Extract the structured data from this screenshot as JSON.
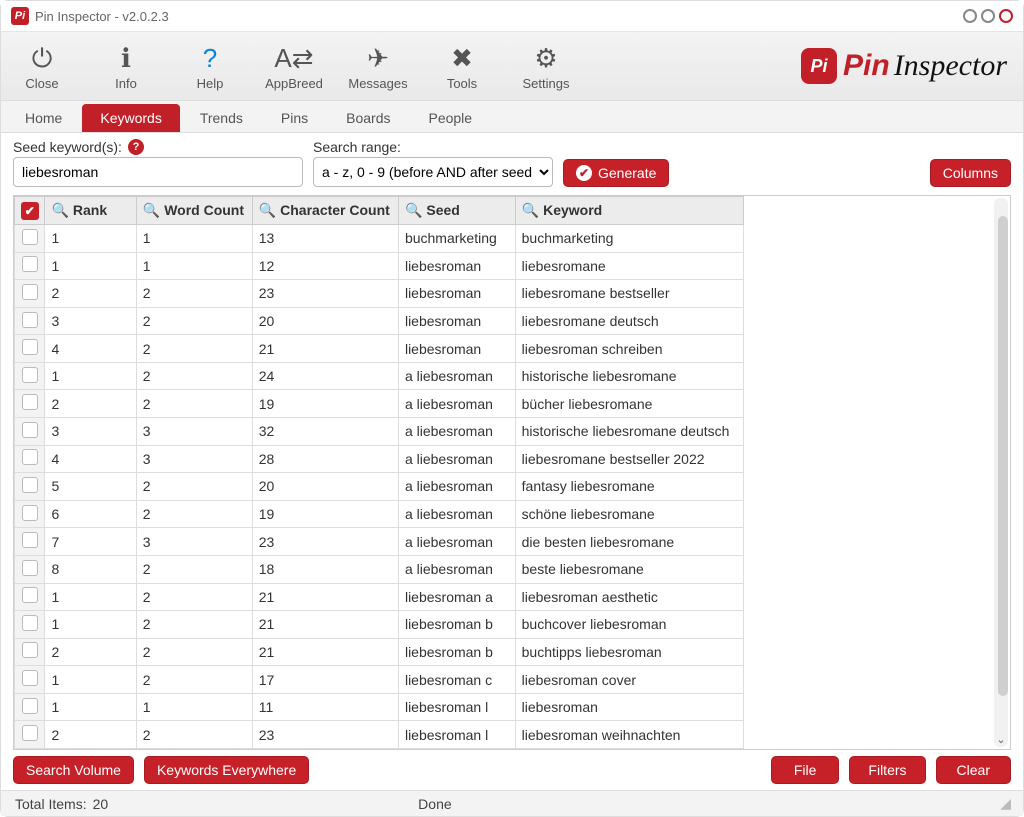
{
  "window": {
    "title": "Pin Inspector - v2.0.2.3"
  },
  "brand": {
    "badge": "Pi",
    "name1": "Pin",
    "name2": "Inspector"
  },
  "ribbon": {
    "items": [
      {
        "key": "close",
        "label": "Close",
        "glyph": "⏻"
      },
      {
        "key": "info",
        "label": "Info",
        "glyph": "ℹ"
      },
      {
        "key": "help",
        "label": "Help",
        "glyph": "?"
      },
      {
        "key": "appbreed",
        "label": "AppBreed",
        "glyph": "A⇄"
      },
      {
        "key": "messages",
        "label": "Messages",
        "glyph": "✈"
      },
      {
        "key": "tools",
        "label": "Tools",
        "glyph": "✖"
      },
      {
        "key": "settings",
        "label": "Settings",
        "glyph": "⚙"
      }
    ]
  },
  "tabs": [
    "Home",
    "Keywords",
    "Trends",
    "Pins",
    "Boards",
    "People"
  ],
  "activeTab": "Keywords",
  "search": {
    "seed_label": "Seed keyword(s):",
    "seed_value": "liebesroman",
    "range_label": "Search range:",
    "range_value": "a - z, 0 - 9 (before AND after seed",
    "generate": "Generate",
    "columns": "Columns"
  },
  "table": {
    "headers": {
      "rank": "Rank",
      "word_count": "Word Count",
      "char_count": "Character Count",
      "seed": "Seed",
      "keyword": "Keyword"
    },
    "rows": [
      {
        "rank": "1",
        "wc": "1",
        "cc": "13",
        "seed": "buchmarketing",
        "kw": "buchmarketing"
      },
      {
        "rank": "1",
        "wc": "1",
        "cc": "12",
        "seed": " liebesroman",
        "kw": "liebesromane"
      },
      {
        "rank": "2",
        "wc": "2",
        "cc": "23",
        "seed": " liebesroman",
        "kw": "liebesromane bestseller"
      },
      {
        "rank": "3",
        "wc": "2",
        "cc": "20",
        "seed": " liebesroman",
        "kw": "liebesromane deutsch"
      },
      {
        "rank": "4",
        "wc": "2",
        "cc": "21",
        "seed": " liebesroman",
        "kw": "liebesroman schreiben"
      },
      {
        "rank": "1",
        "wc": "2",
        "cc": "24",
        "seed": "a liebesroman",
        "kw": "historische liebesromane"
      },
      {
        "rank": "2",
        "wc": "2",
        "cc": "19",
        "seed": "a liebesroman",
        "kw": "bücher liebesromane"
      },
      {
        "rank": "3",
        "wc": "3",
        "cc": "32",
        "seed": "a liebesroman",
        "kw": "historische liebesromane deutsch"
      },
      {
        "rank": "4",
        "wc": "3",
        "cc": "28",
        "seed": "a liebesroman",
        "kw": "liebesromane bestseller 2022"
      },
      {
        "rank": "5",
        "wc": "2",
        "cc": "20",
        "seed": "a liebesroman",
        "kw": "fantasy liebesromane"
      },
      {
        "rank": "6",
        "wc": "2",
        "cc": "19",
        "seed": "a liebesroman",
        "kw": "schöne liebesromane"
      },
      {
        "rank": "7",
        "wc": "3",
        "cc": "23",
        "seed": "a liebesroman",
        "kw": "die besten liebesromane"
      },
      {
        "rank": "8",
        "wc": "2",
        "cc": "18",
        "seed": "a liebesroman",
        "kw": "beste liebesromane"
      },
      {
        "rank": "1",
        "wc": "2",
        "cc": "21",
        "seed": "liebesroman a",
        "kw": "liebesroman aesthetic"
      },
      {
        "rank": "1",
        "wc": "2",
        "cc": "21",
        "seed": "liebesroman b",
        "kw": "buchcover liebesroman"
      },
      {
        "rank": "2",
        "wc": "2",
        "cc": "21",
        "seed": "liebesroman b",
        "kw": "buchtipps liebesroman"
      },
      {
        "rank": "1",
        "wc": "2",
        "cc": "17",
        "seed": "liebesroman c",
        "kw": "liebesroman cover"
      },
      {
        "rank": "1",
        "wc": "1",
        "cc": "11",
        "seed": "liebesroman l",
        "kw": "liebesroman"
      },
      {
        "rank": "2",
        "wc": "2",
        "cc": "23",
        "seed": "liebesroman l",
        "kw": "liebesroman weihnachten"
      }
    ]
  },
  "footer": {
    "search_volume": "Search Volume",
    "keywords_everywhere": "Keywords Everywhere",
    "file": "File",
    "filters": "Filters",
    "clear": "Clear"
  },
  "status": {
    "total_items_label": "Total Items:",
    "total_items_value": "20",
    "state": "Done"
  }
}
